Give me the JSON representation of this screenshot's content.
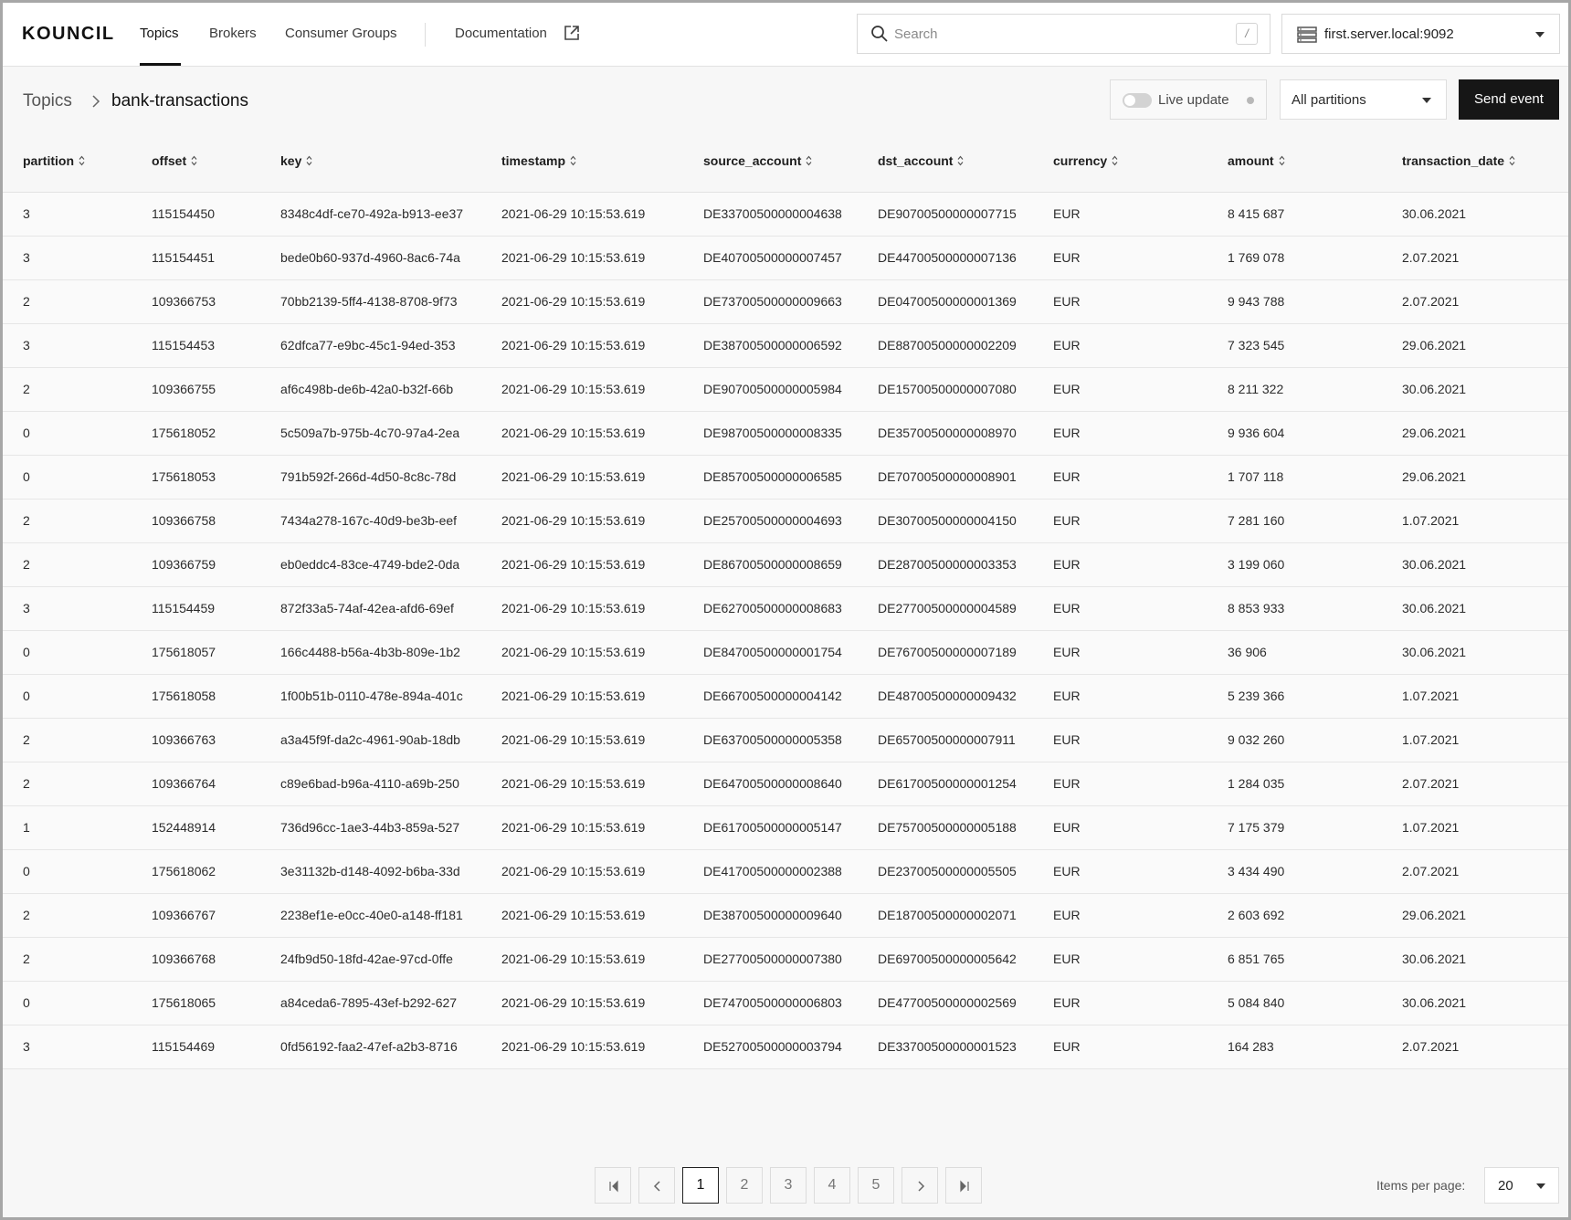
{
  "header": {
    "logo": "KOUNCIL",
    "nav": [
      "Topics",
      "Brokers",
      "Consumer Groups"
    ],
    "documentation_label": "Documentation",
    "search_placeholder": "Search",
    "search_shortcut": "/",
    "server_label": "first.server.local:9092"
  },
  "breadcrumb": {
    "root": "Topics",
    "current": "bank-transactions"
  },
  "toolbar": {
    "live_update_label": "Live update",
    "live_update_on": false,
    "partitions_label": "All partitions",
    "send_event_label": "Send event"
  },
  "table": {
    "columns": [
      "partition",
      "offset",
      "key",
      "timestamp",
      "source_account",
      "dst_account",
      "currency",
      "amount",
      "transaction_date"
    ],
    "rows": [
      [
        "3",
        "115154450",
        "8348c4df-ce70-492a-b913-ee37",
        "2021-06-29 10:15:53.619",
        "DE33700500000004638",
        "DE90700500000007715",
        "EUR",
        "8 415 687",
        "30.06.2021"
      ],
      [
        "3",
        "115154451",
        "bede0b60-937d-4960-8ac6-74a",
        "2021-06-29 10:15:53.619",
        "DE40700500000007457",
        "DE44700500000007136",
        "EUR",
        "1 769 078",
        "2.07.2021"
      ],
      [
        "2",
        "109366753",
        "70bb2139-5ff4-4138-8708-9f73",
        "2021-06-29 10:15:53.619",
        "DE73700500000009663",
        "DE04700500000001369",
        "EUR",
        "9 943 788",
        "2.07.2021"
      ],
      [
        "3",
        "115154453",
        "62dfca77-e9bc-45c1-94ed-353",
        "2021-06-29 10:15:53.619",
        "DE38700500000006592",
        "DE88700500000002209",
        "EUR",
        "7 323 545",
        "29.06.2021"
      ],
      [
        "2",
        "109366755",
        "af6c498b-de6b-42a0-b32f-66b",
        "2021-06-29 10:15:53.619",
        "DE90700500000005984",
        "DE15700500000007080",
        "EUR",
        "8 211 322",
        "30.06.2021"
      ],
      [
        "0",
        "175618052",
        "5c509a7b-975b-4c70-97a4-2ea",
        "2021-06-29 10:15:53.619",
        "DE98700500000008335",
        "DE35700500000008970",
        "EUR",
        "9 936 604",
        "29.06.2021"
      ],
      [
        "0",
        "175618053",
        "791b592f-266d-4d50-8c8c-78d",
        "2021-06-29 10:15:53.619",
        "DE85700500000006585",
        "DE70700500000008901",
        "EUR",
        "1 707 118",
        "29.06.2021"
      ],
      [
        "2",
        "109366758",
        "7434a278-167c-40d9-be3b-eef",
        "2021-06-29 10:15:53.619",
        "DE25700500000004693",
        "DE30700500000004150",
        "EUR",
        "7 281 160",
        "1.07.2021"
      ],
      [
        "2",
        "109366759",
        "eb0eddc4-83ce-4749-bde2-0da",
        "2021-06-29 10:15:53.619",
        "DE86700500000008659",
        "DE28700500000003353",
        "EUR",
        "3 199 060",
        "30.06.2021"
      ],
      [
        "3",
        "115154459",
        "872f33a5-74af-42ea-afd6-69ef",
        "2021-06-29 10:15:53.619",
        "DE62700500000008683",
        "DE27700500000004589",
        "EUR",
        "8 853 933",
        "30.06.2021"
      ],
      [
        "0",
        "175618057",
        "166c4488-b56a-4b3b-809e-1b2",
        "2021-06-29 10:15:53.619",
        "DE84700500000001754",
        "DE76700500000007189",
        "EUR",
        "36 906",
        "30.06.2021"
      ],
      [
        "0",
        "175618058",
        "1f00b51b-0110-478e-894a-401c",
        "2021-06-29 10:15:53.619",
        "DE66700500000004142",
        "DE48700500000009432",
        "EUR",
        "5 239 366",
        "1.07.2021"
      ],
      [
        "2",
        "109366763",
        "a3a45f9f-da2c-4961-90ab-18db",
        "2021-06-29 10:15:53.619",
        "DE63700500000005358",
        "DE65700500000007911",
        "EUR",
        "9 032 260",
        "1.07.2021"
      ],
      [
        "2",
        "109366764",
        "c89e6bad-b96a-4110-a69b-250",
        "2021-06-29 10:15:53.619",
        "DE64700500000008640",
        "DE61700500000001254",
        "EUR",
        "1 284 035",
        "2.07.2021"
      ],
      [
        "1",
        "152448914",
        "736d96cc-1ae3-44b3-859a-527",
        "2021-06-29 10:15:53.619",
        "DE61700500000005147",
        "DE75700500000005188",
        "EUR",
        "7 175 379",
        "1.07.2021"
      ],
      [
        "0",
        "175618062",
        "3e31132b-d148-4092-b6ba-33d",
        "2021-06-29 10:15:53.619",
        "DE41700500000002388",
        "DE23700500000005505",
        "EUR",
        "3 434 490",
        "2.07.2021"
      ],
      [
        "2",
        "109366767",
        "2238ef1e-e0cc-40e0-a148-ff181",
        "2021-06-29 10:15:53.619",
        "DE38700500000009640",
        "DE18700500000002071",
        "EUR",
        "2 603 692",
        "29.06.2021"
      ],
      [
        "2",
        "109366768",
        "24fb9d50-18fd-42ae-97cd-0ffe",
        "2021-06-29 10:15:53.619",
        "DE27700500000007380",
        "DE69700500000005642",
        "EUR",
        "6 851 765",
        "30.06.2021"
      ],
      [
        "0",
        "175618065",
        "a84ceda6-7895-43ef-b292-627",
        "2021-06-29 10:15:53.619",
        "DE74700500000006803",
        "DE47700500000002569",
        "EUR",
        "5 084 840",
        "30.06.2021"
      ],
      [
        "3",
        "115154469",
        "0fd56192-faa2-47ef-a2b3-8716",
        "2021-06-29 10:15:53.619",
        "DE52700500000003794",
        "DE33700500000001523",
        "EUR",
        "164 283",
        "2.07.2021"
      ]
    ]
  },
  "pagination": {
    "pages": [
      "1",
      "2",
      "3",
      "4",
      "5"
    ],
    "current_page": "1",
    "items_per_page_label": "Items per page:",
    "items_per_page": "20"
  },
  "colors": {
    "primary_button": "#161616",
    "text": "#1f1f1f",
    "background": "#f7f7f7"
  }
}
